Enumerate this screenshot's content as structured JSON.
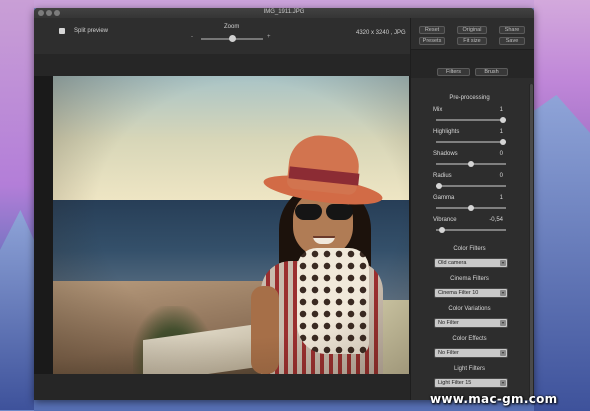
{
  "window": {
    "title": "IMG_1911.JPG"
  },
  "toolbar": {
    "split_preview_label": "Split preview",
    "zoom_label": "Zoom",
    "zoom_minus": "-",
    "zoom_plus": "+",
    "zoom_level": 0.5,
    "image_dimensions": "4320 x 3240 , JPG"
  },
  "panel": {
    "top_buttons": [
      "Reset",
      "Original",
      "Share",
      "Presets",
      "Fit size",
      "Save"
    ],
    "tabs": [
      "Filters",
      "Brush"
    ],
    "preprocessing_title": "Pre-processing",
    "adjustments": [
      {
        "label": "Mix",
        "value": "1",
        "level": 1.0
      },
      {
        "label": "Highlights",
        "value": "1",
        "level": 1.0
      },
      {
        "label": "Shadows",
        "value": "0",
        "level": 0.5
      },
      {
        "label": "Radius",
        "value": "0",
        "level": 0.0
      },
      {
        "label": "Gamma",
        "value": "1",
        "level": 0.5
      },
      {
        "label": "Vibrance",
        "value": "-0,54",
        "level": 0.05
      }
    ],
    "filter_groups": [
      {
        "title": "Color Filters",
        "selected": "Old camera"
      },
      {
        "title": "Cinema Filters",
        "selected": "Cinema Filter 10"
      },
      {
        "title": "Color Variations",
        "selected": "No Filter"
      },
      {
        "title": "Color Effects",
        "selected": "No Filter"
      },
      {
        "title": "Light Filters",
        "selected": "Light Filter 15"
      }
    ]
  },
  "watermark": "www.mac-gm.com"
}
